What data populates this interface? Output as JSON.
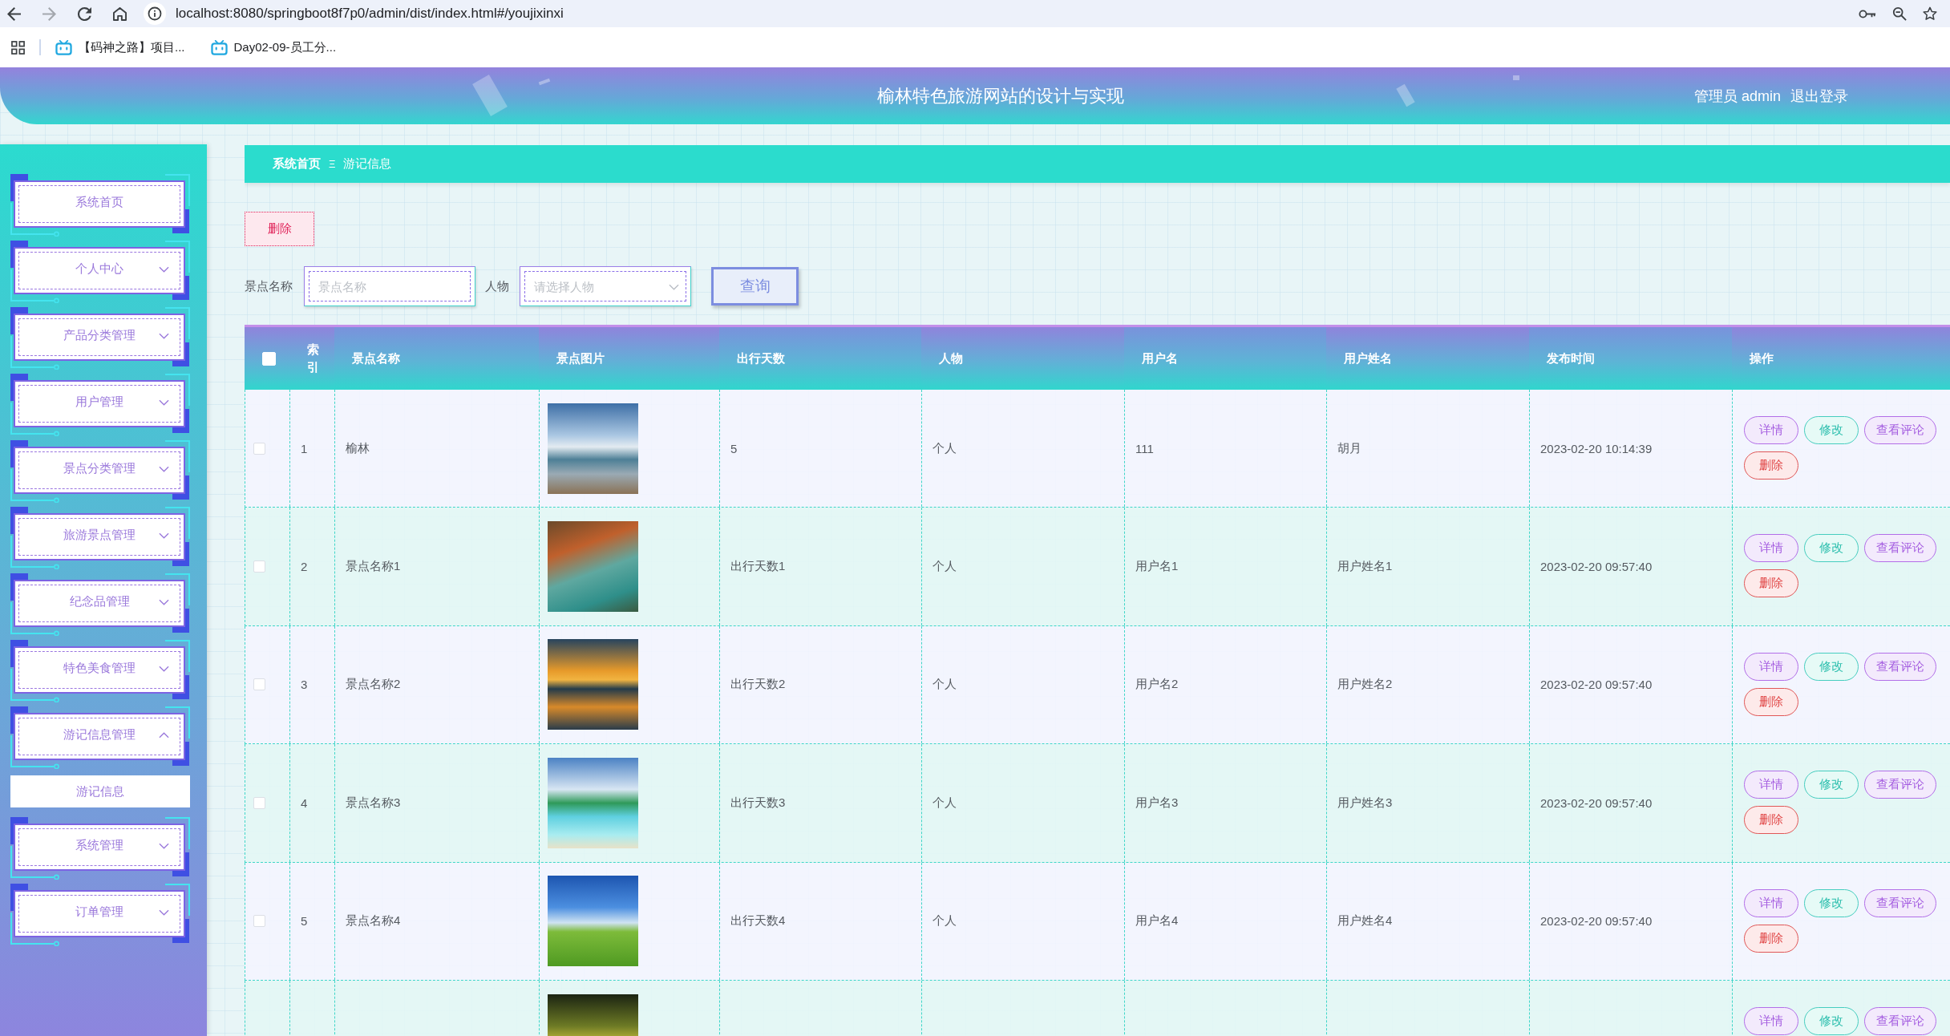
{
  "browser": {
    "url": "localhost:8080/springboot8f7p0/admin/dist/index.html#/youjixinxi",
    "bookmarks": [
      {
        "label": "【码神之路】项目..."
      },
      {
        "label": "Day02-09-员工分..."
      }
    ]
  },
  "header": {
    "title": "榆林特色旅游网站的设计与实现",
    "user": "管理员 admin",
    "logout": "退出登录"
  },
  "sidebar": {
    "items": [
      {
        "label": "系统首页",
        "kind": "link"
      },
      {
        "label": "个人中心",
        "kind": "submenu",
        "expanded": false
      },
      {
        "label": "产品分类管理",
        "kind": "submenu",
        "expanded": false
      },
      {
        "label": "用户管理",
        "kind": "submenu",
        "expanded": false
      },
      {
        "label": "景点分类管理",
        "kind": "submenu",
        "expanded": false
      },
      {
        "label": "旅游景点管理",
        "kind": "submenu",
        "expanded": false
      },
      {
        "label": "纪念品管理",
        "kind": "submenu",
        "expanded": false
      },
      {
        "label": "特色美食管理",
        "kind": "submenu",
        "expanded": false
      },
      {
        "label": "游记信息管理",
        "kind": "submenu",
        "expanded": true,
        "children": [
          {
            "label": "游记信息",
            "selected": true
          }
        ]
      },
      {
        "label": "系统管理",
        "kind": "submenu",
        "expanded": false
      },
      {
        "label": "订单管理",
        "kind": "submenu",
        "expanded": false
      }
    ]
  },
  "breadcrumb": {
    "items": [
      {
        "label": "系统首页"
      },
      {
        "label": "游记信息"
      }
    ],
    "separator": "Ξ"
  },
  "toolbar": {
    "delete_button": "删除"
  },
  "search": {
    "fields": [
      {
        "label": "景点名称",
        "placeholder": "景点名称",
        "kind": "input"
      },
      {
        "label": "人物",
        "placeholder": "请选择人物",
        "kind": "select"
      }
    ],
    "button": "查询"
  },
  "table": {
    "header_checkbox": {
      "checked": false
    },
    "columns": [
      {
        "kind": "text",
        "label": "索引"
      },
      {
        "kind": "text",
        "label": "景点名称"
      },
      {
        "kind": "image",
        "label": "景点图片"
      },
      {
        "kind": "text",
        "label": "出行天数"
      },
      {
        "kind": "text",
        "label": "人物"
      },
      {
        "kind": "text",
        "label": "用户名"
      },
      {
        "kind": "text",
        "label": "用户姓名"
      },
      {
        "kind": "text",
        "label": "发布时间"
      },
      {
        "kind": "actions",
        "label": "操作"
      }
    ],
    "rows": [
      {
        "checked": false,
        "cells": [
          "1",
          "榆林",
          {
            "photo": true
          },
          "5",
          "个人",
          "111",
          "胡月",
          "2023-02-20 10:14:39"
        ],
        "actions": [
          {
            "label": "详情",
            "kind": "detail"
          },
          {
            "label": "修改",
            "kind": "edit"
          },
          {
            "label": "查看评论",
            "kind": "comments"
          },
          {
            "label": "删除",
            "kind": "delete"
          }
        ]
      },
      {
        "checked": false,
        "cells": [
          "2",
          "景点名称1",
          {
            "photo": true
          },
          "出行天数1",
          "个人",
          "用户名1",
          "用户姓名1",
          "2023-02-20 09:57:40"
        ],
        "actions": [
          {
            "label": "详情",
            "kind": "detail"
          },
          {
            "label": "修改",
            "kind": "edit"
          },
          {
            "label": "查看评论",
            "kind": "comments"
          },
          {
            "label": "删除",
            "kind": "delete"
          }
        ]
      },
      {
        "checked": false,
        "cells": [
          "3",
          "景点名称2",
          {
            "photo": true
          },
          "出行天数2",
          "个人",
          "用户名2",
          "用户姓名2",
          "2023-02-20 09:57:40"
        ],
        "actions": [
          {
            "label": "详情",
            "kind": "detail"
          },
          {
            "label": "修改",
            "kind": "edit"
          },
          {
            "label": "查看评论",
            "kind": "comments"
          },
          {
            "label": "删除",
            "kind": "delete"
          }
        ]
      },
      {
        "checked": false,
        "cells": [
          "4",
          "景点名称3",
          {
            "photo": true
          },
          "出行天数3",
          "个人",
          "用户名3",
          "用户姓名3",
          "2023-02-20 09:57:40"
        ],
        "actions": [
          {
            "label": "详情",
            "kind": "detail"
          },
          {
            "label": "修改",
            "kind": "edit"
          },
          {
            "label": "查看评论",
            "kind": "comments"
          },
          {
            "label": "删除",
            "kind": "delete"
          }
        ]
      },
      {
        "checked": false,
        "cells": [
          "5",
          "景点名称4",
          {
            "photo": true
          },
          "出行天数4",
          "个人",
          "用户名4",
          "用户姓名4",
          "2023-02-20 09:57:40"
        ],
        "actions": [
          {
            "label": "详情",
            "kind": "detail"
          },
          {
            "label": "修改",
            "kind": "edit"
          },
          {
            "label": "查看评论",
            "kind": "comments"
          },
          {
            "label": "删除",
            "kind": "delete"
          }
        ]
      },
      {
        "cells": [
          null,
          null,
          {
            "photo": true
          }
        ],
        "actions": [
          {
            "label": "详情",
            "kind": "detail"
          },
          {
            "label": "修改",
            "kind": "edit"
          },
          {
            "label": "查看评论",
            "kind": "comments"
          }
        ]
      }
    ]
  }
}
